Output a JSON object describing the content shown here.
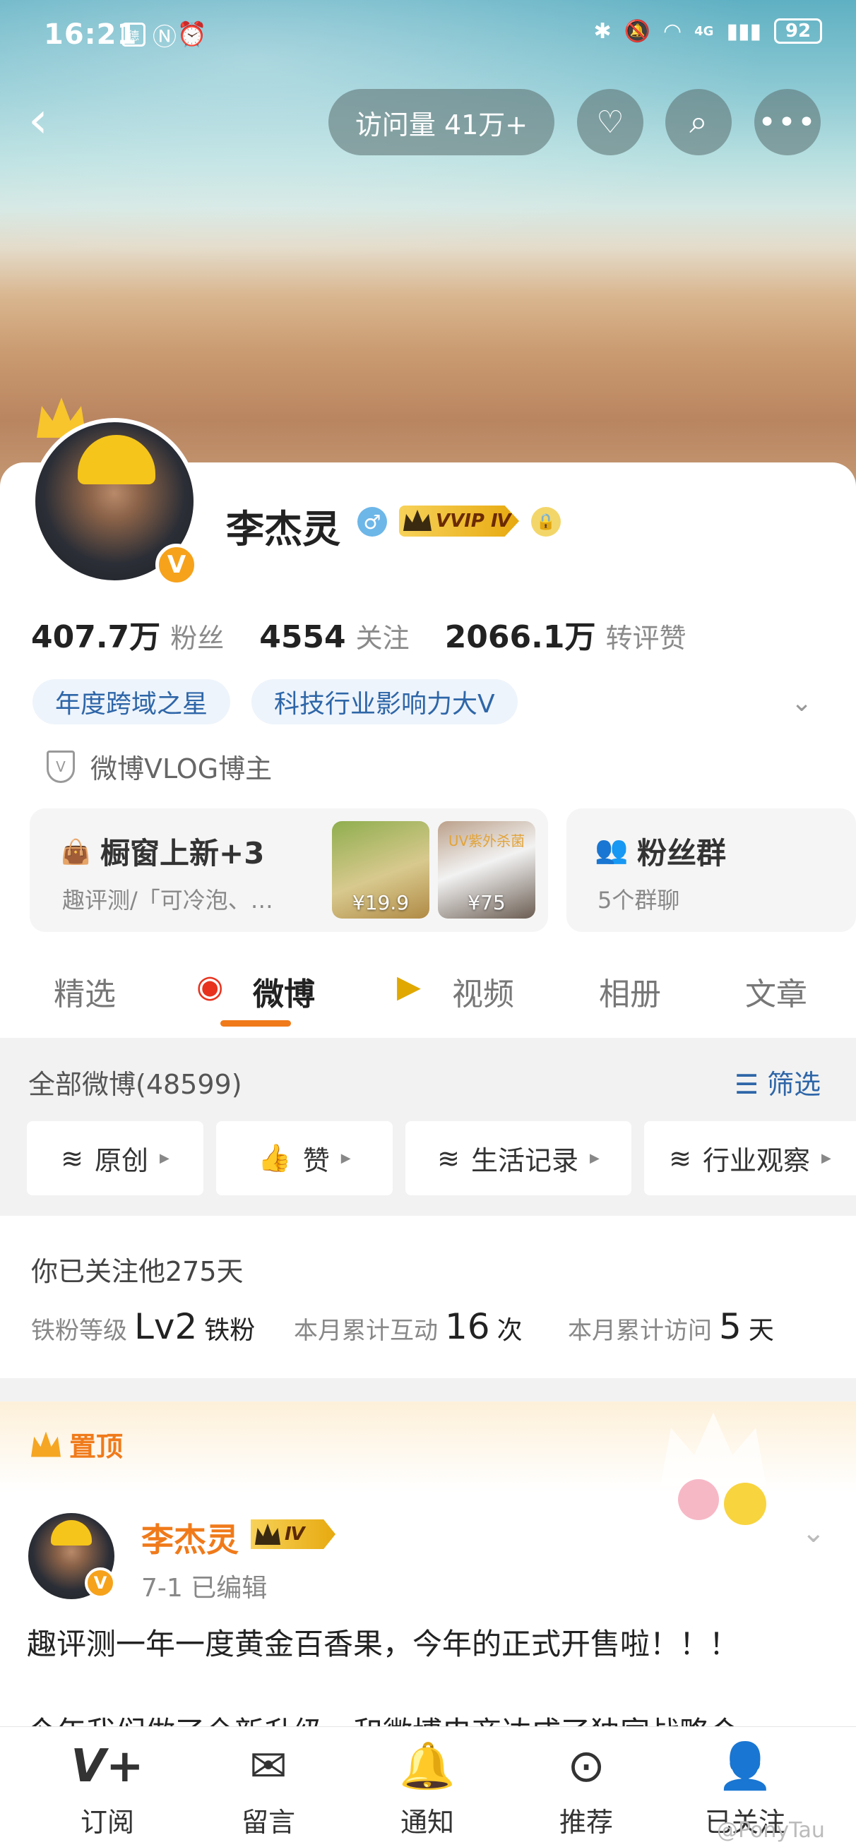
{
  "status_bar": {
    "time": "16:21",
    "battery": "92",
    "net": "4G"
  },
  "header": {
    "visits": "访问量 41万+"
  },
  "profile": {
    "name": "李杰灵",
    "vvip": "VVIP Ⅳ",
    "stats": [
      {
        "value": "407.7万",
        "label": "粉丝"
      },
      {
        "value": "4554",
        "label": "关注"
      },
      {
        "value": "2066.1万",
        "label": "转评赞"
      }
    ],
    "tags": [
      "年度跨域之星",
      "科技行业影响力大V"
    ],
    "vlog": "微博VLOG博主"
  },
  "shop": {
    "title": "橱窗上新+3",
    "sub": "趣评测/「可冷泡、…",
    "p1": "¥19.9",
    "p2": "¥75",
    "p2_top": "UV紫外杀菌"
  },
  "fans_group": {
    "title": "粉丝群",
    "sub": "5个群聊"
  },
  "tabs": [
    "精选",
    "微博",
    "视频",
    "相册",
    "文章"
  ],
  "filter": {
    "all": "全部微博(48599)",
    "filter_label": "筛选",
    "chips": [
      "原创",
      "赞",
      "生活记录",
      "行业观察"
    ]
  },
  "follow": {
    "days": "你已关注他275天",
    "level_label": "铁粉等级",
    "level": "Lv2",
    "level_name": "铁粉",
    "interact_label": "本月累计互动",
    "interact": "16",
    "interact_unit": "次",
    "visit_label": "本月累计访问",
    "visit": "5",
    "visit_unit": "天"
  },
  "post": {
    "pin": "置顶",
    "author": "李杰灵",
    "badge": "Ⅳ",
    "meta": "7-1  已编辑",
    "text": "趣评测一年一度黄金百香果，今年的正式开售啦！！！",
    "text2": "今年我们做了全新升级，和微博电商达成了独家战略合"
  },
  "bottom": [
    "订阅",
    "留言",
    "通知",
    "推荐",
    "已关注"
  ],
  "watermark": "@PonyTau"
}
